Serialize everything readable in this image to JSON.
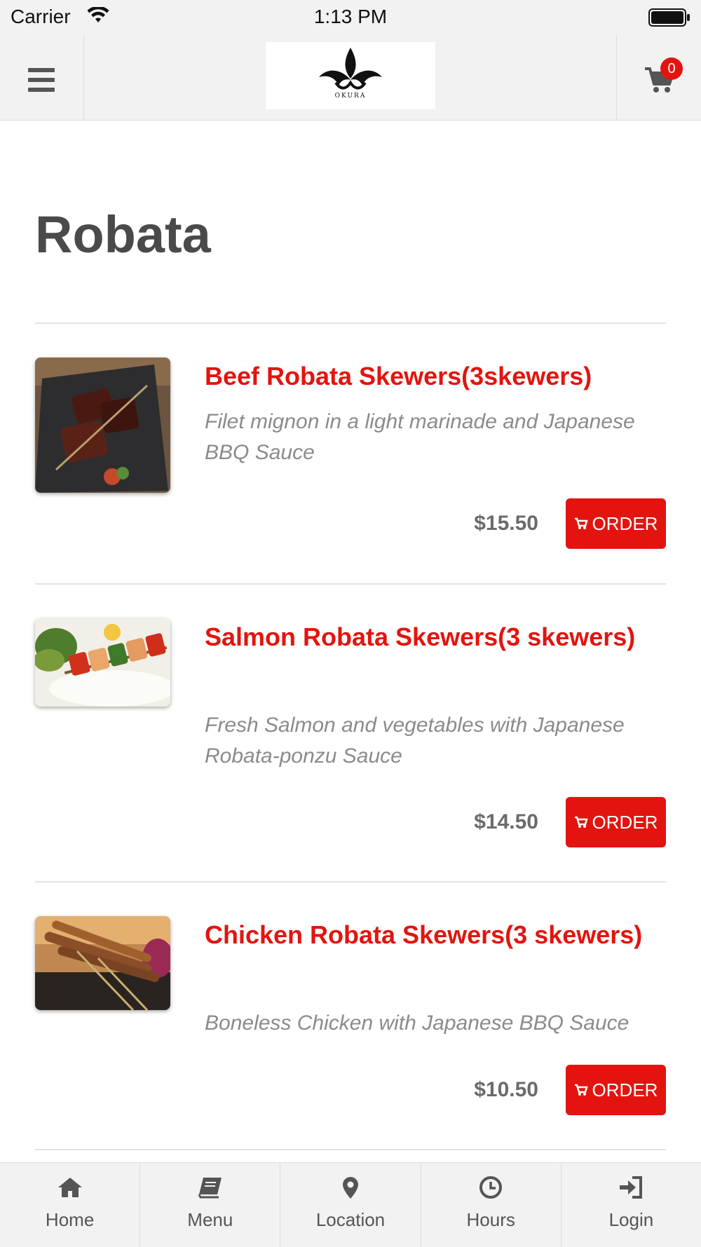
{
  "status_bar": {
    "carrier": "Carrier",
    "time": "1:13 PM"
  },
  "header": {
    "logo_text": "OKURA",
    "cart_count": "0"
  },
  "page": {
    "title": "Robata"
  },
  "items": [
    {
      "name": "Beef Robata Skewers(3skewers)",
      "description": "Filet mignon in a light marinade and Japanese BBQ Sauce",
      "price": "$15.50",
      "order_label": "ORDER"
    },
    {
      "name": "Salmon Robata Skewers(3 skewers)",
      "description": "Fresh Salmon and vegetables with Japanese Robata-ponzu Sauce",
      "price": "$14.50",
      "order_label": "ORDER"
    },
    {
      "name": "Chicken Robata Skewers(3 skewers)",
      "description": "Boneless Chicken with Japanese BBQ Sauce",
      "price": "$10.50",
      "order_label": "ORDER"
    }
  ],
  "tabs": [
    {
      "label": "Home",
      "icon": "home-icon"
    },
    {
      "label": "Menu",
      "icon": "book-icon"
    },
    {
      "label": "Location",
      "icon": "map-pin-icon"
    },
    {
      "label": "Hours",
      "icon": "clock-icon"
    },
    {
      "label": "Login",
      "icon": "login-icon"
    }
  ],
  "colors": {
    "accent": "#e3140f",
    "bar_bg": "#f2f2f2",
    "text_gray": "#8b8b8b"
  }
}
